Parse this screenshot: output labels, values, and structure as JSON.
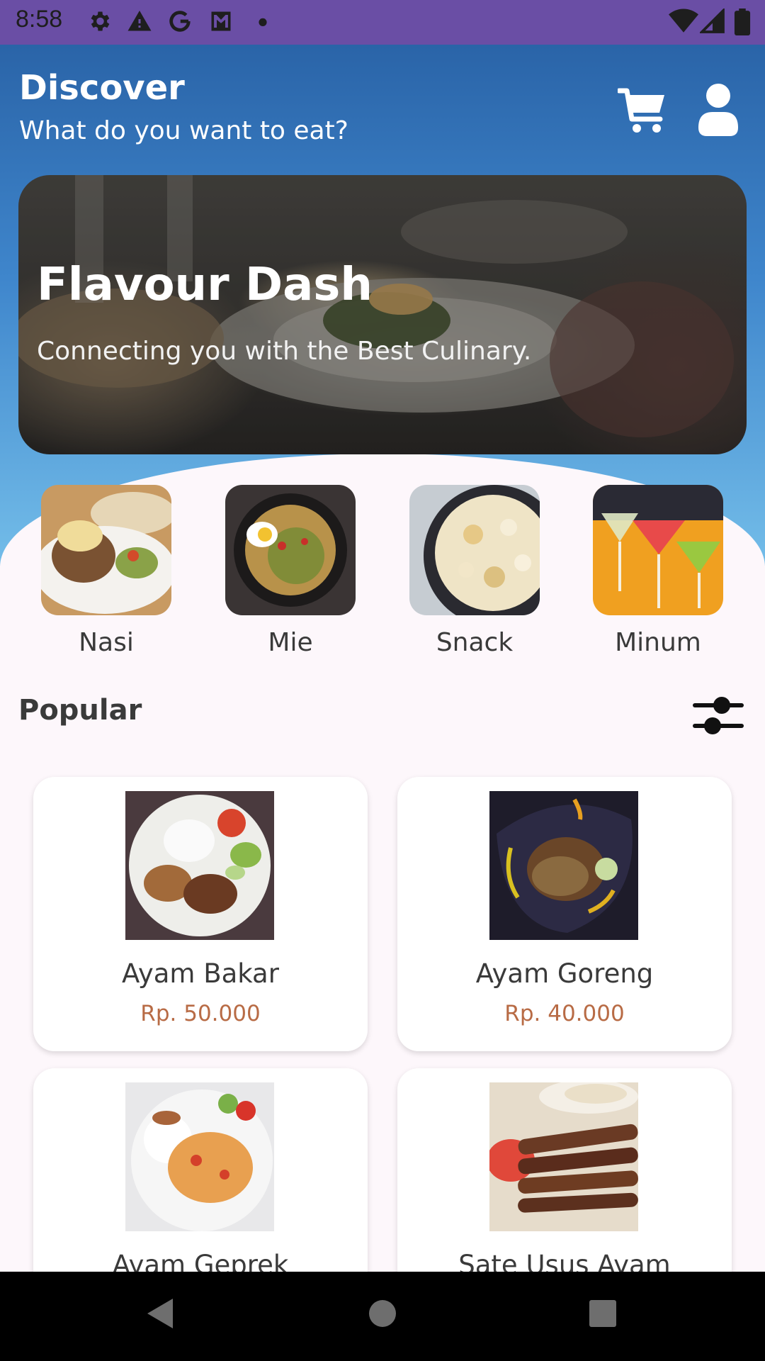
{
  "status_bar": {
    "time": "8:58",
    "icons": [
      "gear-icon",
      "warning-icon",
      "google-icon",
      "mail-icon",
      "dot-icon",
      "wifi-icon",
      "signal-icon",
      "battery-icon"
    ]
  },
  "header": {
    "title": "Discover",
    "subtitle": "What do you want to eat?",
    "icons": [
      "cart-icon",
      "profile-icon"
    ]
  },
  "banner": {
    "title": "Flavour Dash",
    "subtitle": "Connecting you with the Best Culinary."
  },
  "categories": [
    {
      "label": "Nasi"
    },
    {
      "label": "Mie"
    },
    {
      "label": "Snack"
    },
    {
      "label": "Minum"
    }
  ],
  "popular": {
    "title": "Popular",
    "filter_icon": "sliders-icon"
  },
  "foods": [
    {
      "name": "Ayam Bakar",
      "price": "Rp. 50.000"
    },
    {
      "name": "Ayam Goreng",
      "price": "Rp. 40.000"
    },
    {
      "name": "Ayam Geprek",
      "price": ""
    },
    {
      "name": "Sate Usus Ayam",
      "price": ""
    }
  ],
  "colors": {
    "status_bar": "#6a4ea5",
    "header_top": "#2a64a8",
    "header_bottom": "#73bde9",
    "price": "#b86b45",
    "background": "#fdf7fb"
  },
  "nav": [
    "back-icon",
    "home-icon",
    "recents-icon"
  ]
}
